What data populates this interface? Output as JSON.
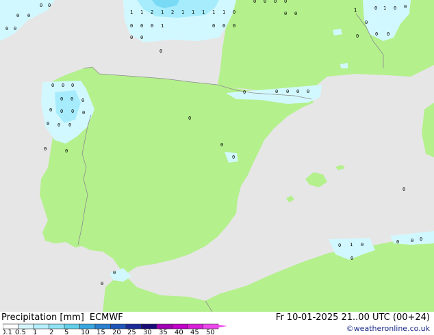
{
  "footer": {
    "title": "Precipitation [mm]",
    "model": "ECMWF",
    "datetime": "Fr 10-01-2025 21..00 UTC (00+24)",
    "credit": "©weatheronline.co.uk"
  },
  "legend": {
    "labels": [
      "0.1",
      "0.5",
      "1",
      "2",
      "5",
      "10",
      "15",
      "20",
      "25",
      "30",
      "35",
      "40",
      "45",
      "50"
    ],
    "colors": [
      "#ffffff",
      "#d6f6ff",
      "#b4eefc",
      "#8ee2f5",
      "#62cfea",
      "#3aa6e0",
      "#2a80d0",
      "#1f55b8",
      "#1a2a98",
      "#1a0c78",
      "#a000b4",
      "#c000c8",
      "#d820d8",
      "#ec48ec"
    ]
  },
  "colors": {
    "sea": "#e6e6e6",
    "land": "#b4f08c",
    "precip_light": "#d2f8ff",
    "precip_medium": "#a6ecfc",
    "precip_heavy": "#78daf4",
    "border": "#8c8c8c"
  },
  "map_values": [
    {
      "id": "v1",
      "value": "0"
    },
    {
      "id": "v2",
      "value": "0"
    },
    {
      "id": "v3",
      "value": "0"
    },
    {
      "id": "v4",
      "value": "0"
    },
    {
      "id": "v5",
      "value": "0"
    },
    {
      "id": "v6",
      "value": "0"
    },
    {
      "id": "v7",
      "value": "1"
    },
    {
      "id": "v8",
      "value": "1"
    },
    {
      "id": "v9",
      "value": "2"
    },
    {
      "id": "v10",
      "value": "1"
    },
    {
      "id": "v11",
      "value": "2"
    },
    {
      "id": "v12",
      "value": "1"
    },
    {
      "id": "v13",
      "value": "1"
    },
    {
      "id": "v14",
      "value": "1"
    },
    {
      "id": "v15",
      "value": "1"
    },
    {
      "id": "v16",
      "value": "1"
    },
    {
      "id": "v17",
      "value": "0"
    },
    {
      "id": "v18",
      "value": "0"
    },
    {
      "id": "v19",
      "value": "0"
    },
    {
      "id": "v20",
      "value": "0"
    },
    {
      "id": "v21",
      "value": "1"
    },
    {
      "id": "v22",
      "value": "0"
    },
    {
      "id": "v23",
      "value": "0"
    },
    {
      "id": "v24",
      "value": "0"
    },
    {
      "id": "v25",
      "value": "0"
    },
    {
      "id": "v26",
      "value": "0"
    },
    {
      "id": "v27",
      "value": "0"
    },
    {
      "id": "v28",
      "value": "0"
    },
    {
      "id": "v29",
      "value": "0"
    },
    {
      "id": "v30",
      "value": "0"
    },
    {
      "id": "v31",
      "value": "0"
    },
    {
      "id": "v32",
      "value": "0"
    },
    {
      "id": "v33",
      "value": "0"
    },
    {
      "id": "v34",
      "value": "1"
    },
    {
      "id": "v35",
      "value": "0"
    },
    {
      "id": "v36",
      "value": "0"
    },
    {
      "id": "v37",
      "value": "1"
    },
    {
      "id": "v38",
      "value": "0"
    },
    {
      "id": "v39",
      "value": "0"
    },
    {
      "id": "v40",
      "value": "0"
    },
    {
      "id": "v41",
      "value": "0"
    },
    {
      "id": "v42",
      "value": "0"
    },
    {
      "id": "v43",
      "value": "0"
    },
    {
      "id": "v44",
      "value": "0"
    },
    {
      "id": "v45",
      "value": "0"
    },
    {
      "id": "v46",
      "value": "0"
    },
    {
      "id": "v47",
      "value": "0"
    },
    {
      "id": "v48",
      "value": "0"
    },
    {
      "id": "v49",
      "value": "0"
    },
    {
      "id": "v50",
      "value": "0"
    },
    {
      "id": "v51",
      "value": "0"
    },
    {
      "id": "v52",
      "value": "0"
    },
    {
      "id": "v53",
      "value": "0"
    },
    {
      "id": "v54",
      "value": "0"
    },
    {
      "id": "v55",
      "value": "0"
    },
    {
      "id": "v56",
      "value": "0"
    },
    {
      "id": "v57",
      "value": "0"
    },
    {
      "id": "v58",
      "value": "0"
    },
    {
      "id": "v59",
      "value": "0"
    },
    {
      "id": "v60",
      "value": "0"
    },
    {
      "id": "v61",
      "value": "0"
    },
    {
      "id": "v62",
      "value": "0"
    },
    {
      "id": "v63",
      "value": "0"
    },
    {
      "id": "v64",
      "value": "0"
    },
    {
      "id": "v65",
      "value": "0"
    },
    {
      "id": "v66",
      "value": "0"
    },
    {
      "id": "v67",
      "value": "0"
    },
    {
      "id": "v68",
      "value": "0"
    },
    {
      "id": "v69",
      "value": "0"
    },
    {
      "id": "v70",
      "value": "1"
    },
    {
      "id": "v71",
      "value": "0"
    },
    {
      "id": "v72",
      "value": "0"
    },
    {
      "id": "v73",
      "value": "0"
    },
    {
      "id": "v74",
      "value": "0"
    },
    {
      "id": "v75",
      "value": "0"
    }
  ]
}
